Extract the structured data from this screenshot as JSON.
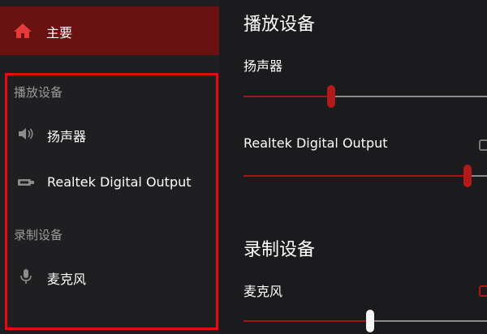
{
  "sidebar": {
    "main_label": "主要",
    "playback_section": "播放设备",
    "playback_items": [
      {
        "label": "扬声器",
        "icon": "speaker-icon"
      },
      {
        "label": "Realtek Digital Output",
        "icon": "digital-output-icon"
      }
    ],
    "recording_section": "录制设备",
    "recording_items": [
      {
        "label": "麦克风",
        "icon": "microphone-icon"
      }
    ]
  },
  "content": {
    "playback_heading": "播放设备",
    "recording_heading": "录制设备",
    "devices": [
      {
        "label": "扬声器",
        "level": 0.36,
        "checked": false
      },
      {
        "label": "Realtek Digital Output",
        "level": 0.92,
        "checked": false
      },
      {
        "label": "麦克风",
        "level": 0.52,
        "checked": false
      }
    ]
  },
  "colors": {
    "accent": "#a11616",
    "main_nav_bg": "#6a1112",
    "highlight_border": "#e50c0c",
    "background": "#1b1a1c"
  }
}
